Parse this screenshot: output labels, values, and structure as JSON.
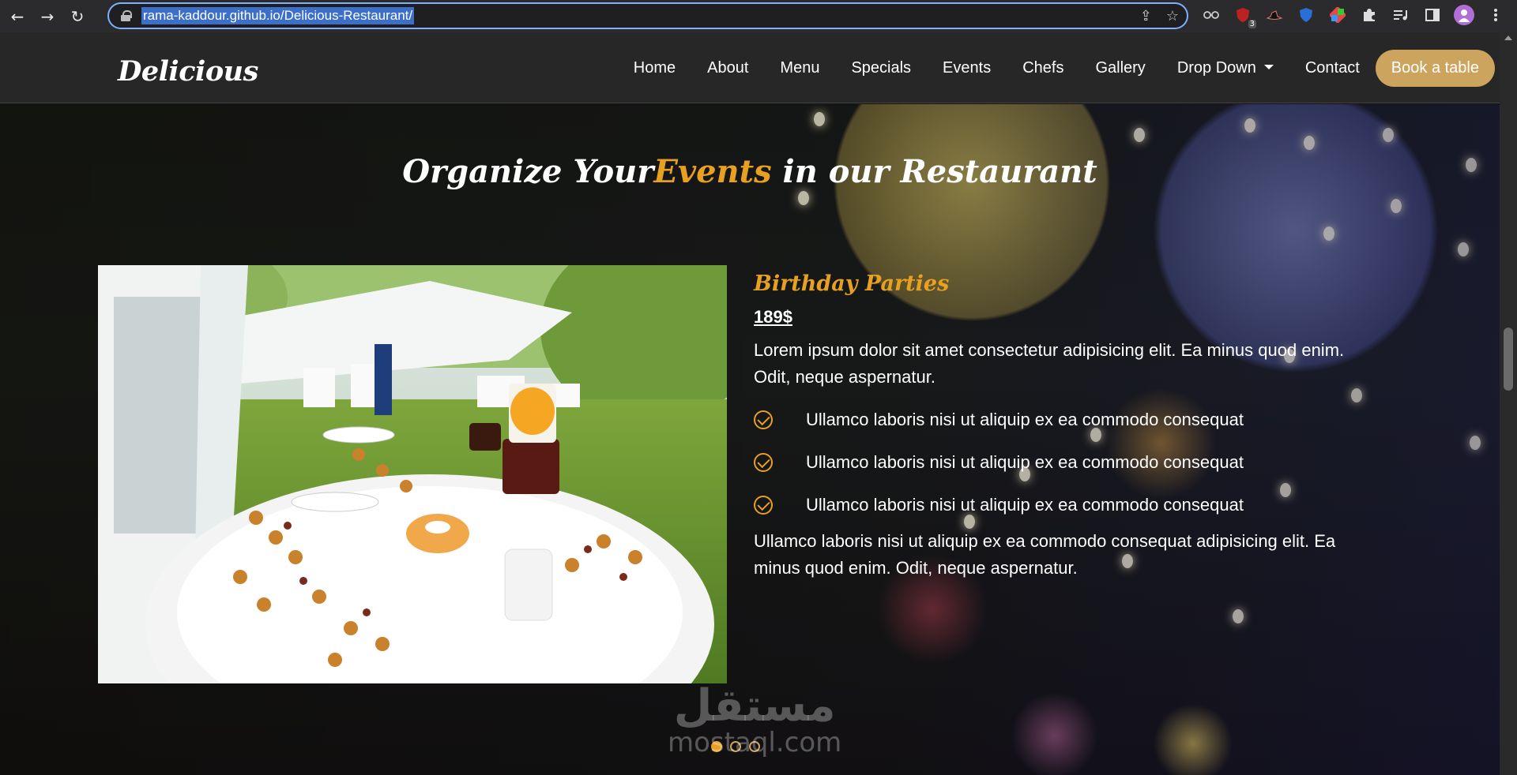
{
  "browser": {
    "url": "rama-kaddour.github.io/Delicious-Restaurant/",
    "back_icon": "←",
    "forward_icon": "→",
    "reload_icon": "↻",
    "share_icon": "⇪",
    "star_icon": "☆",
    "extension_badge": "3"
  },
  "site": {
    "logo": "Delicious",
    "nav": {
      "home": "Home",
      "about": "About",
      "menu": "Menu",
      "specials": "Specials",
      "events": "Events",
      "chefs": "Chefs",
      "gallery": "Gallery",
      "dropdown": "Drop Down",
      "contact": "Contact",
      "book": "Book a table"
    }
  },
  "events": {
    "title_prefix": "Organize Your",
    "title_accent": "Events",
    "title_suffix": " in our Restaurant",
    "item": {
      "name": "Birthday Parties",
      "price": "189$",
      "description": "Lorem ipsum dolor sit amet consectetur adipisicing elit. Ea minus quod enim. Odit, neque aspernatur.",
      "features": [
        "Ullamco laboris nisi ut aliquip ex ea commodo consequat",
        "Ullamco laboris nisi ut aliquip ex ea commodo consequat",
        "Ullamco laboris nisi ut aliquip ex ea commodo consequat"
      ],
      "note": "Ullamco laboris nisi ut aliquip ex ea commodo consequat adipisicing elit. Ea minus quod enim. Odit, neque aspernatur."
    },
    "pagination": {
      "total": 3,
      "active": 1
    }
  },
  "watermark": {
    "arabic": "مستقل",
    "latin": "mostaql.com"
  },
  "colors": {
    "accent": "#e8a021",
    "button": "#cda45e",
    "header_bg": "#282828"
  }
}
